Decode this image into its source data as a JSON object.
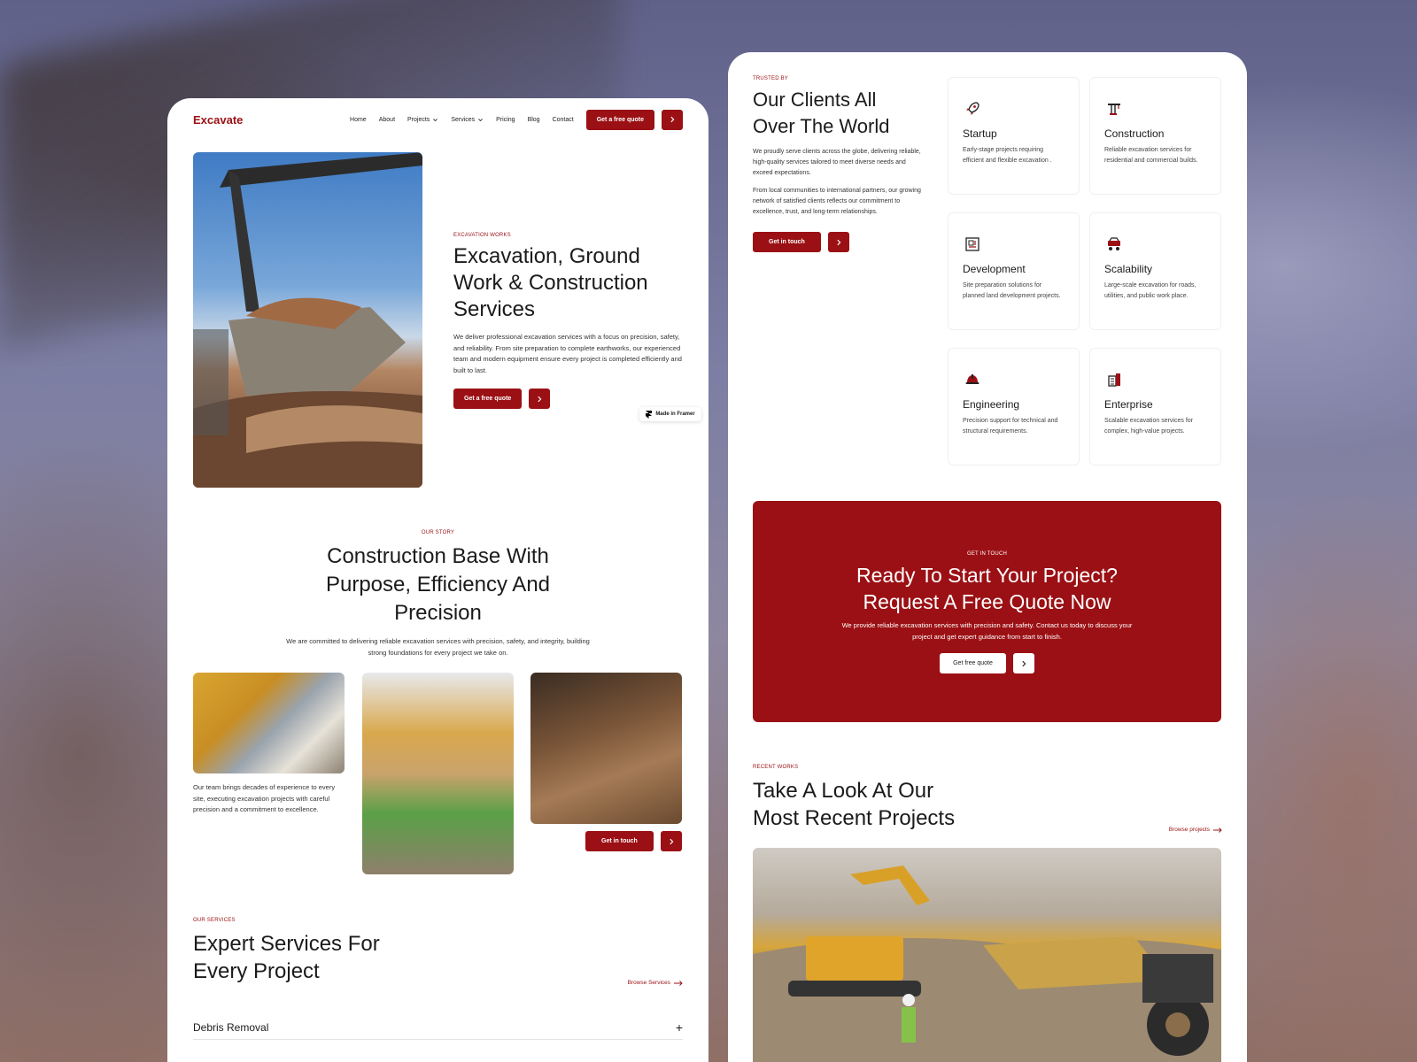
{
  "left": {
    "nav": {
      "logo": "Excavate",
      "links": [
        "Home",
        "About",
        "Projects",
        "Services",
        "Pricing",
        "Blog",
        "Contact"
      ],
      "cta": "Get a free quote"
    },
    "hero": {
      "eyebrow": "EXCAVATION WORKS",
      "title": "Excavation, Ground Work & Construction Services",
      "desc": "We deliver professional excavation services with a focus on precision, safety, and reliability. From site preparation to complete earthworks, our experienced team and modern equipment ensure every project is completed efficiently and built to last.",
      "cta": "Get a free quote",
      "badge": "Made in Framer"
    },
    "story": {
      "eyebrow": "OUR STORY",
      "title": "Construction Base With Purpose, Efficiency And Precision",
      "desc": "We are committed to delivering reliable excavation services with precision, safety, and integrity, building strong foundations for every project we take on.",
      "caption": "Our team brings decades of experience to every site, executing excavation projects with careful precision and a commitment to excellence.",
      "cta": "Get in touch"
    },
    "services": {
      "eyebrow": "OUR SERVICES",
      "title": "Expert Services For Every Project",
      "browse": "Browse Services",
      "first_item": "Debris Removal",
      "plus": "+"
    }
  },
  "right": {
    "clients": {
      "eyebrow": "TRUSTED BY",
      "title": "Our Clients All Over The World",
      "desc1": "We proudly serve clients across the globe, delivering reliable, high-quality services tailored to meet diverse needs and exceed expectations.",
      "desc2": "From local communities to international partners, our growing network of satisfied clients reflects our commitment to excellence, trust, and long-term relationships.",
      "cta": "Get in touch"
    },
    "cards": [
      {
        "title": "Startup",
        "desc": "Early-stage projects requiring efficient and flexible excavation .",
        "icon": "rocket-icon"
      },
      {
        "title": "Construction",
        "desc": "Reliable excavation services for residential and commercial builds.",
        "icon": "crane-icon"
      },
      {
        "title": "Development",
        "desc": "Site preparation solutions for planned land development projects.",
        "icon": "blueprint-icon"
      },
      {
        "title": "Scalability",
        "desc": "Large-scale excavation for roads, utilities, and public work place.",
        "icon": "excavator-icon"
      },
      {
        "title": "Engineering",
        "desc": "Precision support for technical and structural requirements.",
        "icon": "hard-hat-icon"
      },
      {
        "title": "Enterprise",
        "desc": "Scalable excavation services for complex, high-value projects.",
        "icon": "building-icon"
      }
    ],
    "cta_block": {
      "eyebrow": "GET IN TOUCH",
      "title": "Ready To Start Your Project? Request A Free Quote Now",
      "desc": "We provide reliable excavation services with precision and safety. Contact us today to discuss your project and get expert guidance from start to finish.",
      "cta": "Get free quote"
    },
    "recent": {
      "eyebrow": "RECENT WORKS",
      "title": "Take A Look At Our Most Recent Projects",
      "browse": "Browse projects"
    }
  },
  "colors": {
    "accent": "#9b1014",
    "background": "#ffffff"
  }
}
